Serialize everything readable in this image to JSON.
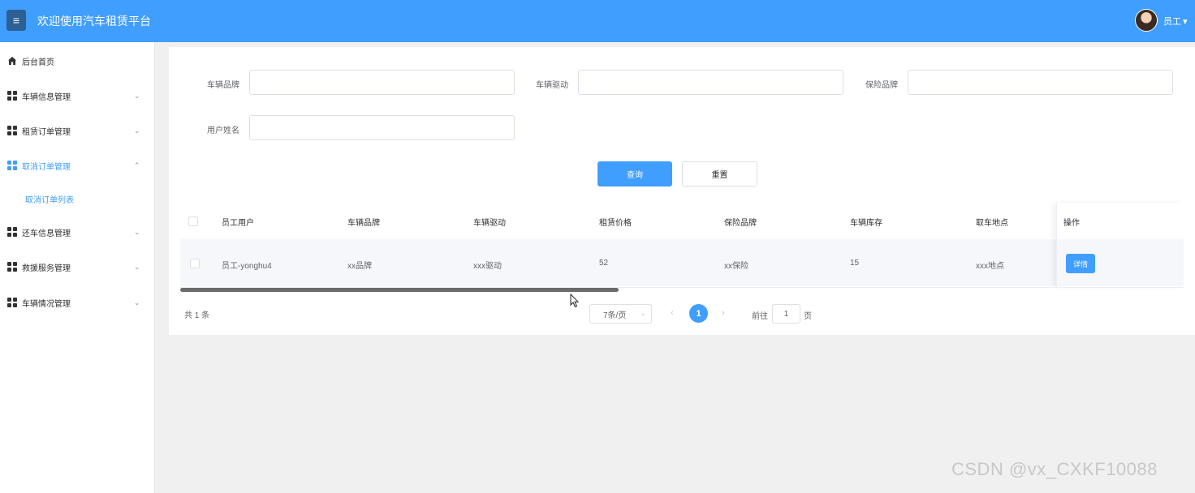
{
  "header": {
    "menu_icon": "hamburger-icon",
    "title": "欢迎使用汽车租赁平台",
    "user_label": "员工",
    "user_caret": "▾",
    "accent_color": "#409eff"
  },
  "sidebar": {
    "items": [
      {
        "label": "后台首页",
        "icon": "home-icon",
        "arrow": ""
      },
      {
        "label": "车辆信息管理",
        "icon": "grid-icon",
        "arrow": "⌄"
      },
      {
        "label": "租赁订单管理",
        "icon": "grid-icon",
        "arrow": "⌄"
      },
      {
        "label": "取消订单管理",
        "icon": "grid-icon",
        "arrow": "⌃"
      },
      {
        "label": "还车信息管理",
        "icon": "grid-icon",
        "arrow": "⌄"
      },
      {
        "label": "救援服务管理",
        "icon": "grid-icon",
        "arrow": "⌄"
      },
      {
        "label": "车辆情况管理",
        "icon": "grid-icon",
        "arrow": "⌄"
      }
    ],
    "sub_item": "取消订单列表"
  },
  "search_form": {
    "fields": [
      {
        "label": "车辆品牌",
        "value": ""
      },
      {
        "label": "车辆驱动",
        "value": ""
      },
      {
        "label": "保险品牌",
        "value": ""
      },
      {
        "label": "用户姓名",
        "value": ""
      }
    ],
    "query_button": "查询",
    "reset_button": "重置"
  },
  "table": {
    "columns": [
      "员工用户",
      "车辆品牌",
      "车辆驱动",
      "租赁价格",
      "保险品牌",
      "车辆库存",
      "取车地点",
      "操作"
    ],
    "rows": [
      [
        "员工-yonghu4",
        "xx品牌",
        "xxx驱动",
        "52",
        "xx保险",
        "15",
        "xxx地点"
      ]
    ],
    "detail_button": "详情"
  },
  "pagination": {
    "total": "共 1 条",
    "page_size": "7条/页",
    "current_page": "1",
    "goto_prefix": "前往",
    "goto_value": "1",
    "goto_suffix": "页"
  },
  "watermark": "CSDN @vx_CXKF10088"
}
